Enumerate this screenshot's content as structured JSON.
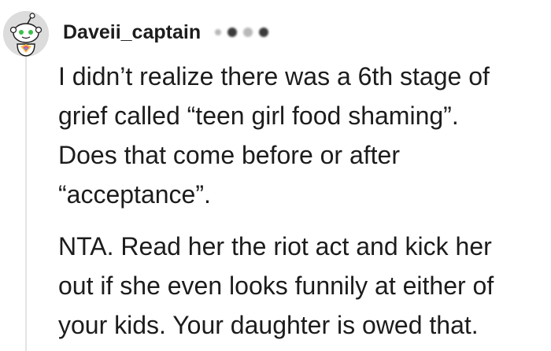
{
  "comment": {
    "author": "Daveii_captain",
    "paragraphs": [
      {
        "lines": [
          "I didn’t realize there was a 6th stage of",
          "grief called “teen girl food shaming”.",
          "Does that come before or after",
          "“acceptance”."
        ]
      },
      {
        "lines": [
          "NTA. Read her the riot act and kick her",
          "out if she even looks funnily at either of",
          "your kids. Your daughter is owed that."
        ]
      }
    ]
  },
  "colors": {
    "text": "#1c1c1c",
    "avatar_bg": "#d9d9d9",
    "thread_line": "#e4e4e4"
  },
  "icons": {
    "avatar": "snoo-avatar-icon"
  }
}
